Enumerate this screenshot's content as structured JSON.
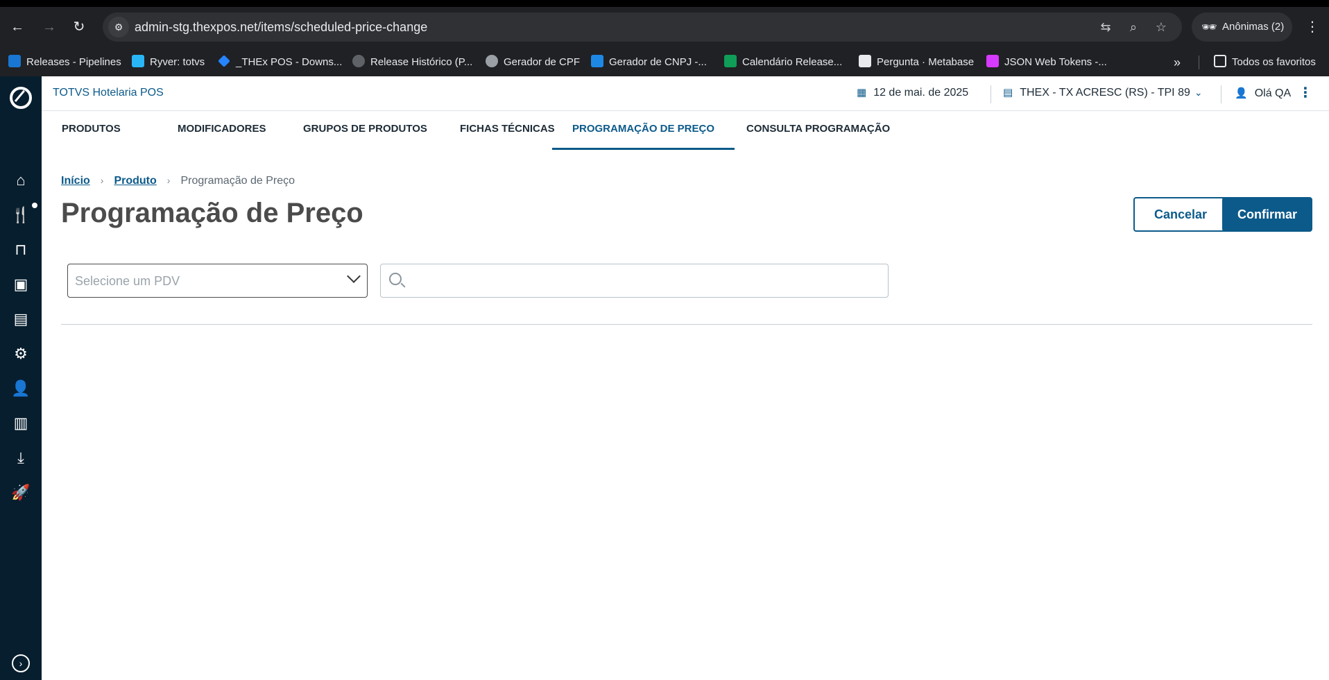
{
  "browser": {
    "url": "admin-stg.thexpos.net/items/scheduled-price-change",
    "profile": "Anônimas (2)",
    "bookmarks": [
      {
        "label": "Releases - Pipelines",
        "color": "#1976d2"
      },
      {
        "label": "Ryver: totvs",
        "color": "#29b6f6"
      },
      {
        "label": "_THEx POS - Downs...",
        "color": "#2684ff"
      },
      {
        "label": "Release Histórico (P...",
        "color": "#5f6368"
      },
      {
        "label": "Gerador de CPF",
        "color": "#9aa0a6"
      },
      {
        "label": "Gerador de CNPJ -...",
        "color": "#1e88e5"
      },
      {
        "label": "Calendário Release...",
        "color": "#0f9d58"
      },
      {
        "label": "Pergunta · Metabase",
        "color": "#e8eaed"
      },
      {
        "label": "JSON Web Tokens -...",
        "color": "#d63aff"
      }
    ],
    "all_bookmarks": "Todos os favoritos"
  },
  "header": {
    "app_title": "TOTVS Hotelaria POS",
    "date": "12 de mai. de 2025",
    "store": "THEX - TX ACRESC (RS) - TPI 89",
    "greeting": "Olá QA"
  },
  "tabs": [
    {
      "label": "PRODUTOS"
    },
    {
      "label": "MODIFICADORES"
    },
    {
      "label": "GRUPOS DE PRODUTOS"
    },
    {
      "label": "FICHAS TÉCNICAS"
    },
    {
      "label": "PROGRAMAÇÃO DE PREÇO"
    },
    {
      "label": "CONSULTA PROGRAMAÇÃO"
    }
  ],
  "breadcrumb": {
    "home": "Início",
    "product": "Produto",
    "current": "Programação de Preço"
  },
  "page": {
    "title": "Programação de Preço",
    "cancel_label": "Cancelar",
    "confirm_label": "Confirmar",
    "pdv_placeholder": "Selecione um PDV",
    "search_value": ""
  }
}
